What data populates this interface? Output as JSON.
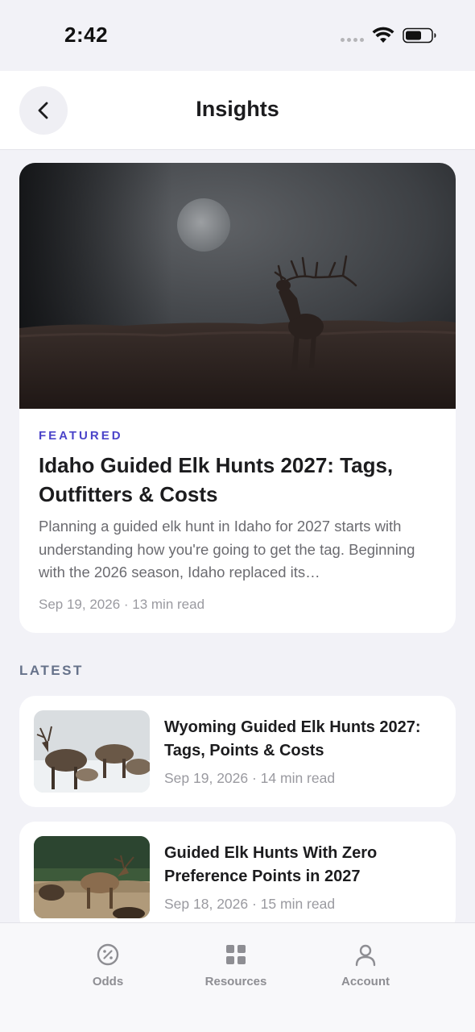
{
  "status_bar": {
    "time": "2:42"
  },
  "header": {
    "title": "Insights"
  },
  "featured": {
    "tag": "FEATURED",
    "title": "Idaho Guided Elk Hunts 2027: Tags, Outfitters & Costs",
    "excerpt": "Planning a guided elk hunt in Idaho for 2027 starts with understanding how you're going to get the tag. Beginning with the 2026 season, Idaho replaced its…",
    "meta": "Sep 19, 2026 · 13 min read"
  },
  "latest": {
    "label": "LATEST",
    "items": [
      {
        "title": "Wyoming Guided Elk Hunts 2027: Tags, Points & Costs",
        "meta": "Sep 19, 2026 · 14 min read"
      },
      {
        "title": "Guided Elk Hunts With Zero Preference Points in 2027",
        "meta": "Sep 18, 2026 · 15 min read"
      }
    ]
  },
  "tab_bar": {
    "tabs": [
      {
        "label": "Odds",
        "icon": "percent-circle-icon"
      },
      {
        "label": "Resources",
        "icon": "grid-icon"
      },
      {
        "label": "Account",
        "icon": "person-icon"
      }
    ]
  },
  "colors": {
    "accent": "#4b44c9",
    "background": "#f2f2f7",
    "section_label": "#66728a",
    "muted_text": "#9a9aa0",
    "tab_inactive": "#8e8e93"
  }
}
